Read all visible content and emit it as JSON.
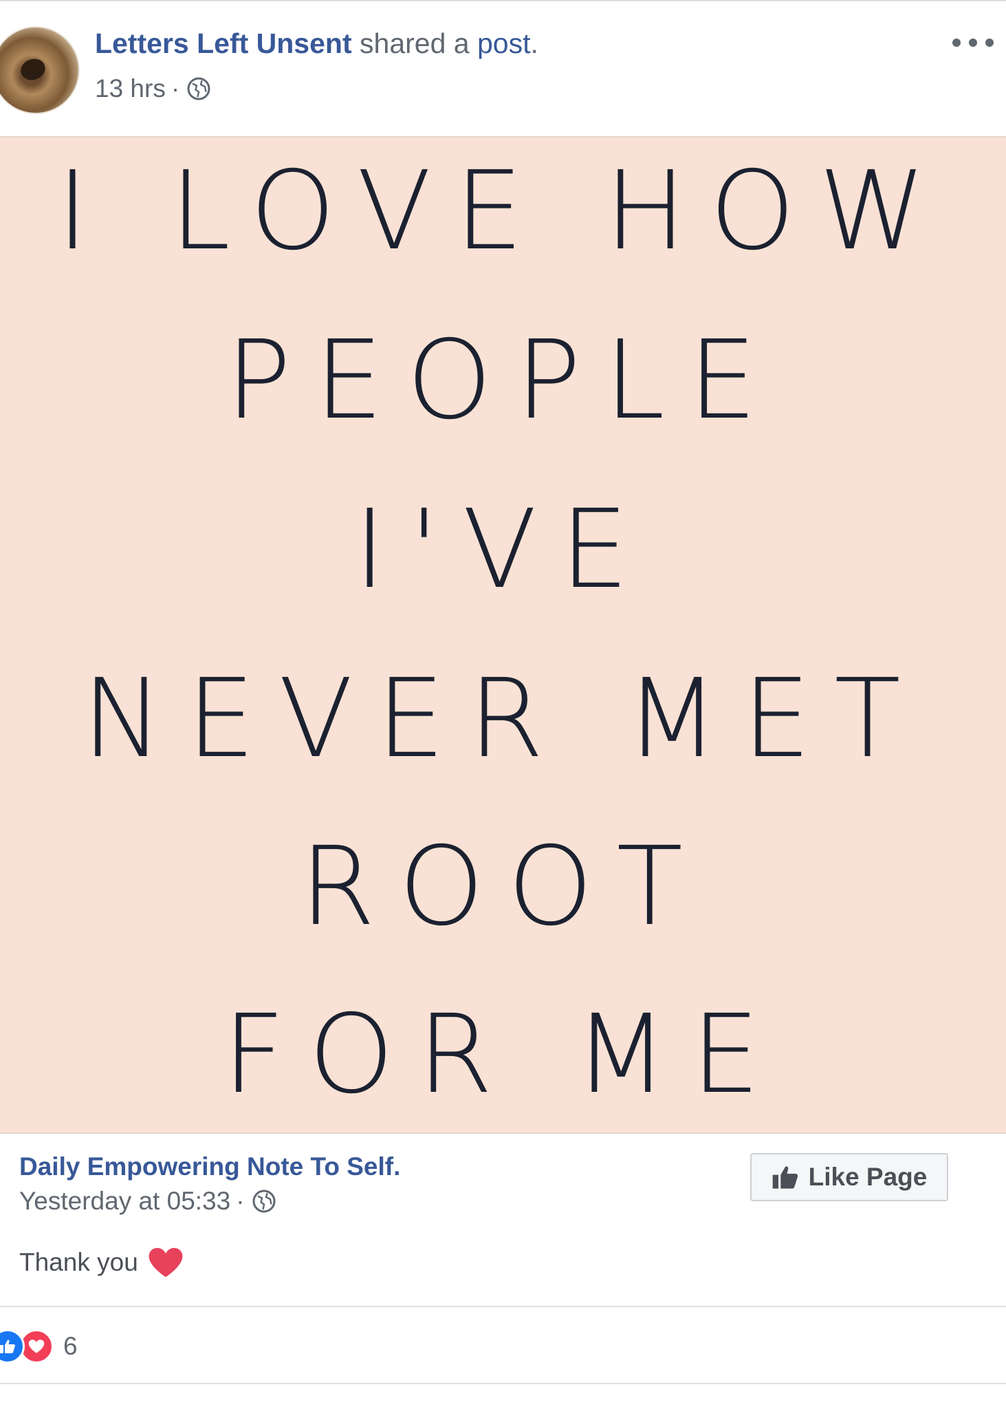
{
  "post_header": {
    "page_name": "Letters Left Unsent",
    "shared_text": "shared a",
    "post_link": "post",
    "period": ".",
    "time": "13 hrs",
    "separator": "·"
  },
  "quote_image": {
    "lines": [
      "I LOVE HOW",
      "PEOPLE",
      "I'VE",
      "NEVER MET",
      "ROOT",
      "FOR ME"
    ],
    "background_color": "#f9e2d5",
    "text_color": "#1b2130"
  },
  "original_post": {
    "page_name": "Daily Empowering Note To Self.",
    "time": "Yesterday at 05:33",
    "separator": "·",
    "like_page_label": "Like Page",
    "text": "Thank you"
  },
  "reactions": {
    "count": "6"
  },
  "colors": {
    "link": "#385898",
    "meta": "#606770",
    "like_blue": "#1877f2",
    "love_red": "#f33e58"
  }
}
